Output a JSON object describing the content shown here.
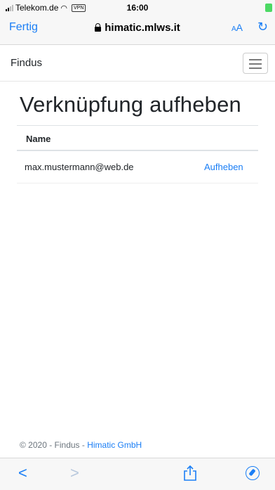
{
  "status_bar": {
    "carrier": "Telekom.de",
    "vpn": "VPN",
    "time": "16:00"
  },
  "browser": {
    "done_label": "Fertig",
    "url": "himatic.mlws.it",
    "text_size_label": "AA",
    "reload_icon": "reload-icon"
  },
  "navbar": {
    "brand": "Findus",
    "menu_icon": "hamburger-icon"
  },
  "page": {
    "title": "Verknüpfung aufheben",
    "table": {
      "header": "Name",
      "rows": [
        {
          "name": "max.mustermann@web.de",
          "action": "Aufheben"
        }
      ]
    }
  },
  "footer": {
    "prefix": "© 2020 - Findus - ",
    "link": "Himatic GmbH"
  },
  "toolbar": {
    "icons": [
      "back-icon",
      "forward-icon",
      "share-icon",
      "compass-icon"
    ]
  },
  "colors": {
    "accent": "#1a7ef5",
    "text": "#212529",
    "muted": "#6c757d"
  }
}
